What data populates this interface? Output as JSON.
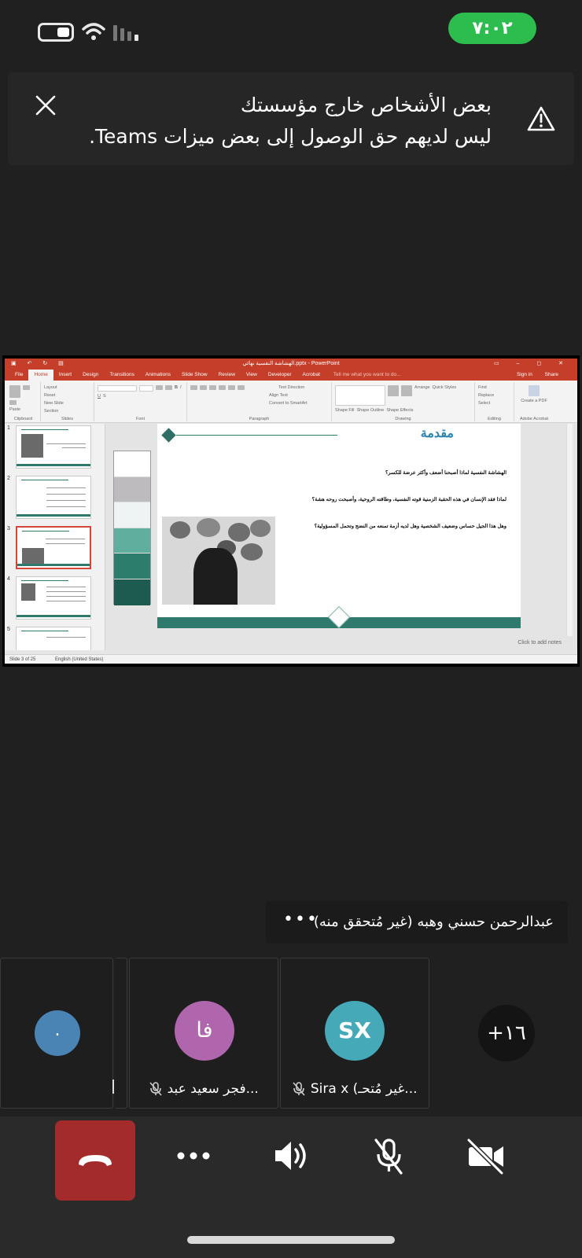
{
  "status_bar": {
    "time": "٧:٠٢",
    "time_pill_color": "#2dbd4f"
  },
  "banner": {
    "line1": "بعض الأشخاص خارج مؤسستك",
    "line2": "ليس لديهم حق الوصول إلى بعض ميزات Teams.",
    "icon": "warning-icon",
    "close_icon": "close-icon"
  },
  "shared_screen": {
    "window_title": "الهشاشة النفسية نهائي.pptx - PowerPoint",
    "tabs": [
      "File",
      "Home",
      "Insert",
      "Design",
      "Transitions",
      "Animations",
      "Slide Show",
      "Review",
      "View",
      "Developer",
      "Acrobat"
    ],
    "active_tab": "Home",
    "tell_me": "Tell me what you want to do...",
    "sign_in": "Sign in",
    "share": "Share",
    "ribbon_groups": [
      {
        "label": "Clipboard",
        "items": [
          "Paste"
        ]
      },
      {
        "label": "Slides",
        "items": [
          "Layout",
          "Reset",
          "New Slide",
          "Section"
        ]
      },
      {
        "label": "Font",
        "items": [
          "B",
          "I",
          "U",
          "S"
        ]
      },
      {
        "label": "Paragraph",
        "items": [
          "Text Direction",
          "Align Text",
          "Convert to SmartArt"
        ]
      },
      {
        "label": "Drawing",
        "items": [
          "Arrange",
          "Quick Styles",
          "Shape Fill",
          "Shape Outline",
          "Shape Effects"
        ]
      },
      {
        "label": "Editing",
        "items": [
          "Find",
          "Replace",
          "Select"
        ]
      },
      {
        "label": "Adobe Acrobat",
        "items": [
          "Create a PDF"
        ]
      }
    ],
    "thumbnail_numbers": [
      "1",
      "2",
      "3",
      "4",
      "5"
    ],
    "selected_slide": 3,
    "slide": {
      "title": "مقدمة",
      "lines": [
        "الهشاشة النفسية لماذا أصبحنا أضعف وأكثر عرضة للكسر؟",
        "لماذا فقد الإنسان في هذه الحقبة الزمنية قوته النفسية، وطاقته الروحية، وأصبحت روحه هشة؟",
        "وهل هذا الجيل حساس وضعيف الشخصية وهل لديه أزمة تمنعه من النضج وتحمل المسؤولية؟"
      ],
      "accent_color": "#2f7a6d"
    },
    "palette_colors": [
      "#ffffff",
      "#bdbbbe",
      "#edf4f3",
      "#5fae9e",
      "#2c7d6c",
      "#1d5b50"
    ],
    "notes_hint": "Click to add notes",
    "status": {
      "slide_count": "Slide 3 of 25",
      "language": "English (United States)"
    }
  },
  "active_speaker": {
    "name": "عبدالرحمن حسني وهبه (غير مُتحقق منه)",
    "more_label": "•••"
  },
  "participants": [
    {
      "initials": ".",
      "name": "",
      "avatar_color": "#4a84b5"
    },
    {
      "initials": "فا",
      "name": "فجر سعيد عبد...",
      "avatar_color": "#b066ad",
      "muted": true
    },
    {
      "initials": "SX",
      "name": "Sira x (غير مُتحـ...",
      "avatar_color": "#46a9b8",
      "muted": true
    }
  ],
  "more_participants": "+١٦",
  "controls": {
    "hangup": "hangup-icon",
    "more": "•••",
    "speaker": "speaker-icon",
    "mic": "mic-off-icon",
    "camera": "camera-off-icon",
    "hangup_color": "#a32b2b"
  }
}
